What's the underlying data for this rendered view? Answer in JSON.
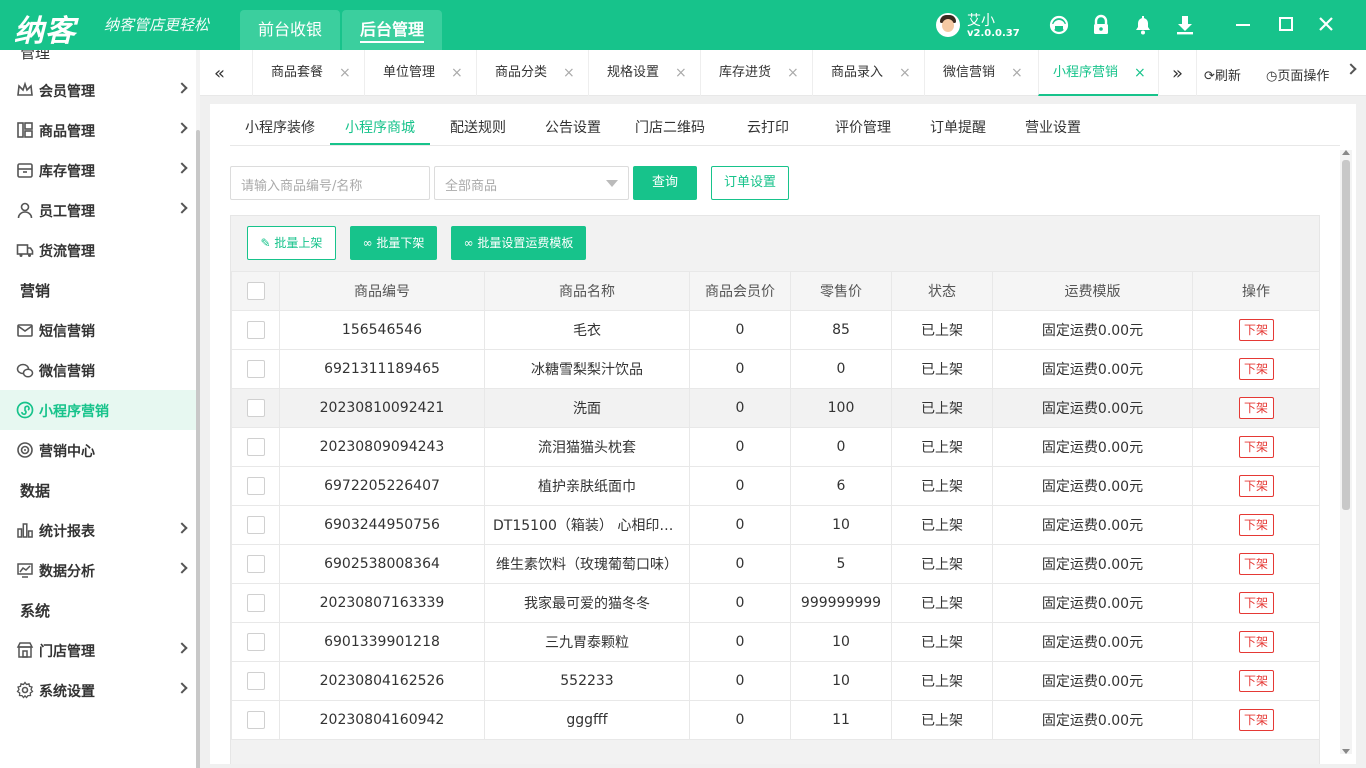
{
  "app": {
    "logo": "纳客",
    "slogan": "纳客管店更轻松",
    "top_tabs": [
      "前台收银",
      "后台管理"
    ],
    "user": {
      "name": "艾小",
      "version": "v2.0.0.37"
    }
  },
  "sidebar": {
    "cut_label": "管理",
    "items": [
      {
        "label": "会员管理",
        "icon": "member-icon",
        "chevron": true
      },
      {
        "label": "商品管理",
        "icon": "goods-icon",
        "chevron": true
      },
      {
        "label": "库存管理",
        "icon": "inventory-icon",
        "chevron": true
      },
      {
        "label": "员工管理",
        "icon": "staff-icon",
        "chevron": true
      },
      {
        "label": "货流管理",
        "icon": "logistics-icon",
        "chevron": false
      }
    ],
    "section_marketing": "营销",
    "marketing_items": [
      {
        "label": "短信营销",
        "icon": "sms-icon"
      },
      {
        "label": "微信营销",
        "icon": "wechat-icon"
      },
      {
        "label": "小程序营销",
        "icon": "miniprogram-icon"
      },
      {
        "label": "营销中心",
        "icon": "target-icon"
      }
    ],
    "section_data": "数据",
    "data_items": [
      {
        "label": "统计报表",
        "icon": "bar-chart-icon"
      },
      {
        "label": "数据分析",
        "icon": "analysis-icon"
      }
    ],
    "section_system": "系统",
    "system_items": [
      {
        "label": "门店管理",
        "icon": "store-icon"
      },
      {
        "label": "系统设置",
        "icon": "settings-icon"
      }
    ]
  },
  "page_tabs": {
    "items": [
      "商品套餐",
      "单位管理",
      "商品分类",
      "规格设置",
      "库存进货",
      "商品录入",
      "微信营销",
      "小程序营销"
    ],
    "active": "小程序营销",
    "refresh": "刷新",
    "page_ops": "页面操作"
  },
  "sub_tabs": {
    "items": [
      "小程序装修",
      "小程序商城",
      "配送规则",
      "公告设置",
      "门店二维码",
      "云打印",
      "评价管理",
      "订单提醒",
      "营业设置"
    ],
    "active": "小程序商城"
  },
  "filters": {
    "search_placeholder": "请输入商品编号/名称",
    "category_select": "全部商品",
    "query_button": "查询",
    "order_settings_button": "订单设置"
  },
  "batch_buttons": {
    "on_shelf": "批量上架",
    "off_shelf": "批量下架",
    "set_shipping": "批量设置运费模板"
  },
  "table": {
    "columns": [
      "商品编号",
      "商品名称",
      "商品会员价",
      "零售价",
      "状态",
      "运费模版",
      "操作"
    ],
    "rows": [
      {
        "code": "156546546",
        "name": "毛衣",
        "member_price": "0",
        "retail": "85",
        "status": "已上架",
        "shipping": "固定运费0.00元",
        "action": "下架"
      },
      {
        "code": "6921311189465",
        "name": "冰糖雪梨梨汁饮品",
        "member_price": "0",
        "retail": "0",
        "status": "已上架",
        "shipping": "固定运费0.00元",
        "action": "下架"
      },
      {
        "code": "20230810092421",
        "name": "洗面",
        "member_price": "0",
        "retail": "100",
        "status": "已上架",
        "shipping": "固定运费0.00元",
        "action": "下架"
      },
      {
        "code": "20230809094243",
        "name": "流泪猫猫头枕套",
        "member_price": "0",
        "retail": "0",
        "status": "已上架",
        "shipping": "固定运费0.00元",
        "action": "下架"
      },
      {
        "code": "6972205226407",
        "name": "植护亲肤纸面巾",
        "member_price": "0",
        "retail": "6",
        "status": "已上架",
        "shipping": "固定运费0.00元",
        "action": "下架"
      },
      {
        "code": "6903244950756",
        "name": "DT15100（箱装） 心相印茶...",
        "member_price": "0",
        "retail": "10",
        "status": "已上架",
        "shipping": "固定运费0.00元",
        "action": "下架"
      },
      {
        "code": "6902538008364",
        "name": "维生素饮料（玫瑰葡萄口味）",
        "member_price": "0",
        "retail": "5",
        "status": "已上架",
        "shipping": "固定运费0.00元",
        "action": "下架"
      },
      {
        "code": "20230807163339",
        "name": "我家最可爱的猫冬冬",
        "member_price": "0",
        "retail": "999999999",
        "status": "已上架",
        "shipping": "固定运费0.00元",
        "action": "下架"
      },
      {
        "code": "6901339901218",
        "name": "三九胃泰颗粒",
        "member_price": "0",
        "retail": "10",
        "status": "已上架",
        "shipping": "固定运费0.00元",
        "action": "下架"
      },
      {
        "code": "20230804162526",
        "name": "552233",
        "member_price": "0",
        "retail": "10",
        "status": "已上架",
        "shipping": "固定运费0.00元",
        "action": "下架"
      },
      {
        "code": "20230804160942",
        "name": "gggfff",
        "member_price": "0",
        "retail": "11",
        "status": "已上架",
        "shipping": "固定运费0.00元",
        "action": "下架"
      }
    ]
  },
  "colors": {
    "primary": "#17c38b",
    "danger": "#e53935"
  }
}
